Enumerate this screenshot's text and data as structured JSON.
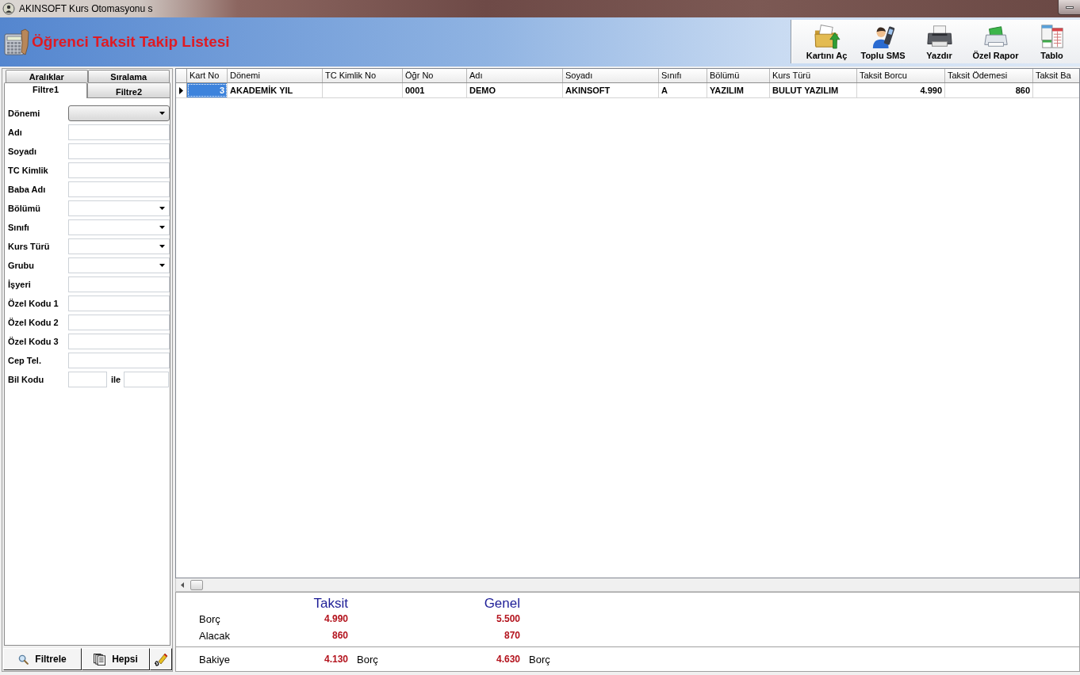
{
  "window": {
    "title": "AKINSOFT Kurs Otomasyonu s"
  },
  "header": {
    "title": "Öğrenci Taksit Takip Listesi"
  },
  "toolbar": {
    "buttons": [
      "Kartını Aç",
      "Toplu SMS",
      "Yazdır",
      "Özel Rapor",
      "Tablo"
    ]
  },
  "filter_panel": {
    "tab_rows": [
      [
        {
          "label": "Aralıklar",
          "selected": false
        },
        {
          "label": "Sıralama",
          "selected": false
        }
      ],
      [
        {
          "label": "Filtre1",
          "selected": true
        },
        {
          "label": "Filtre2",
          "selected": false
        }
      ]
    ],
    "fields": [
      {
        "label": "Dönemi",
        "kind": "combo"
      },
      {
        "label": "Adı",
        "kind": "text"
      },
      {
        "label": "Soyadı",
        "kind": "text"
      },
      {
        "label": "TC Kimlik",
        "kind": "text"
      },
      {
        "label": "Baba Adı",
        "kind": "text"
      },
      {
        "label": "Bölümü",
        "kind": "dropdown"
      },
      {
        "label": "Sınıfı",
        "kind": "dropdown"
      },
      {
        "label": "Kurs Türü",
        "kind": "dropdown"
      },
      {
        "label": "Grubu",
        "kind": "dropdown"
      },
      {
        "label": "İşyeri",
        "kind": "text"
      },
      {
        "label": "Özel Kodu 1",
        "kind": "text"
      },
      {
        "label": "Özel Kodu 2",
        "kind": "text"
      },
      {
        "label": "Özel Kodu 3",
        "kind": "text"
      },
      {
        "label": "Cep Tel.",
        "kind": "text"
      },
      {
        "label": "Bil Kodu",
        "kind": "range",
        "joiner": "ile"
      }
    ],
    "buttons": [
      "Filtrele",
      "Hepsi"
    ]
  },
  "table": {
    "columns": [
      "Kart No",
      "Dönemi",
      "TC Kimlik No",
      "Öğr No",
      "Adı",
      "Soyadı",
      "Sınıfı",
      "Bölümü",
      "Kurs Türü",
      "Taksit Borcu",
      "Taksit Ödemesi",
      "Taksit Ba"
    ],
    "rows": [
      {
        "selected": true,
        "cells": [
          "3",
          "AKADEMİK YIL",
          null,
          "0001",
          "DEMO",
          "AKINSOFT",
          "A",
          "YAZILIM",
          "BULUT YAZILIM",
          "4.990",
          "860",
          null
        ]
      }
    ]
  },
  "summary": {
    "columns": [
      "Taksit",
      "Genel"
    ],
    "rows": [
      {
        "label": "Borç",
        "amounts": [
          "4.990",
          "5.500"
        ]
      },
      {
        "label": "Alacak",
        "amounts": [
          "860",
          "870"
        ]
      }
    ],
    "balance": {
      "label": "Bakiye",
      "amounts": [
        {
          "amount": "4.130",
          "side": "Borç"
        },
        {
          "amount": "4.630",
          "side": "Borç"
        }
      ]
    }
  }
}
